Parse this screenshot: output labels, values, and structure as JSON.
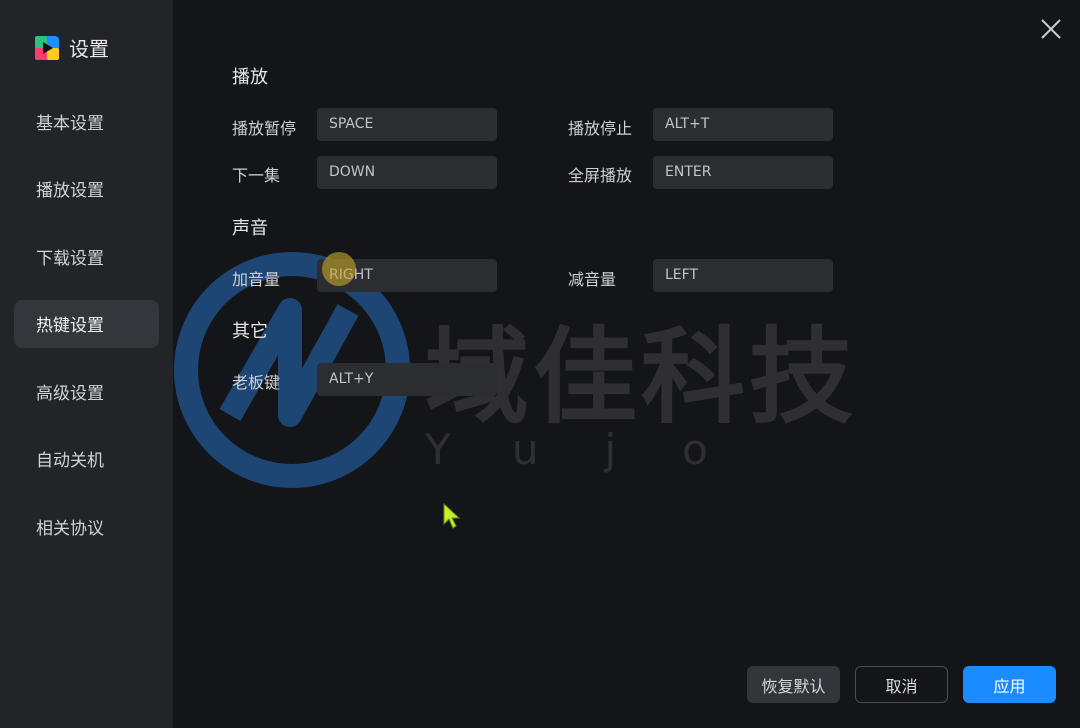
{
  "app": {
    "title": "设置"
  },
  "sidebar": {
    "items": [
      {
        "label": "基本设置",
        "active": false
      },
      {
        "label": "播放设置",
        "active": false
      },
      {
        "label": "下载设置",
        "active": false
      },
      {
        "label": "热键设置",
        "active": true
      },
      {
        "label": "高级设置",
        "active": false
      },
      {
        "label": "自动关机",
        "active": false
      },
      {
        "label": "相关协议",
        "active": false
      }
    ]
  },
  "sections": {
    "playback": {
      "title": "播放",
      "play_pause": {
        "label": "播放暂停",
        "value": "SPACE"
      },
      "play_stop": {
        "label": "播放停止",
        "value": "ALT+T"
      },
      "next_episode": {
        "label": "下一集",
        "value": "DOWN"
      },
      "fullscreen": {
        "label": "全屏播放",
        "value": "ENTER"
      }
    },
    "sound": {
      "title": "声音",
      "volume_up": {
        "label": "加音量",
        "value": "RIGHT"
      },
      "volume_down": {
        "label": "减音量",
        "value": "LEFT"
      }
    },
    "other": {
      "title": "其它",
      "boss_key": {
        "label": "老板键",
        "value": "ALT+Y"
      }
    }
  },
  "buttons": {
    "reset": "恢复默认",
    "cancel": "取消",
    "apply": "应用"
  },
  "watermark": {
    "text": "域佳科技",
    "subtext": "Yujo"
  },
  "colors": {
    "accent": "#1a8cff",
    "sidebar_bg": "#232428",
    "content_bg": "#141518",
    "input_bg": "#2c2d31",
    "watermark_ring": "#1f4f85"
  },
  "icons": {
    "brand": "app-logo-icon",
    "close": "close-icon",
    "cursor": "mouse-cursor-icon"
  }
}
